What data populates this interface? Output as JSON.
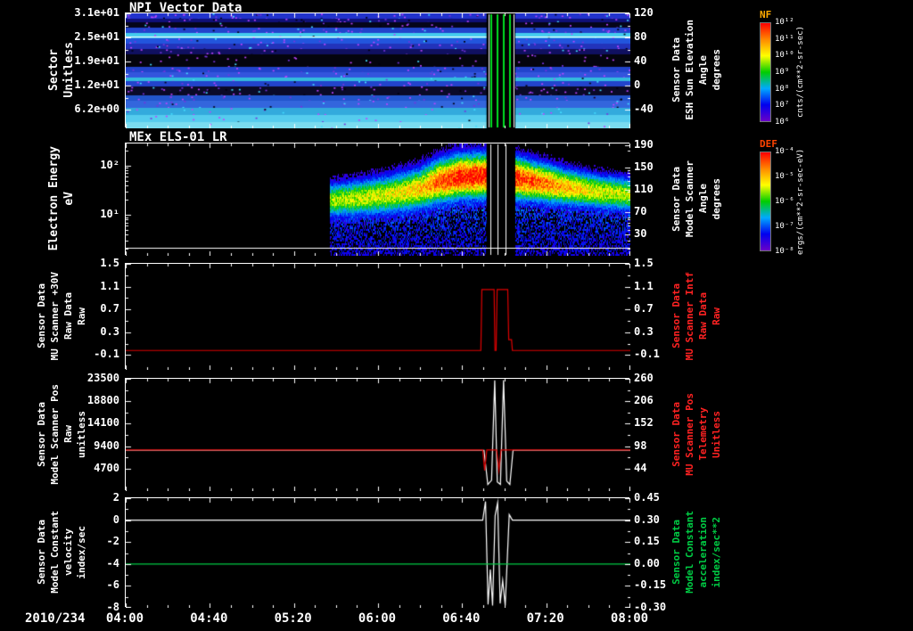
{
  "chart_data": {
    "type": "multi-panel-time-series-spectrogram",
    "date_label": "2010/234",
    "x_axis": {
      "hours_range": [
        4,
        8
      ],
      "tick_labels": [
        "04:00",
        "04:40",
        "05:20",
        "06:00",
        "06:40",
        "07:20",
        "08:00"
      ],
      "minor_divisions": 4
    },
    "palette": {
      "jet_stops": [
        "#6a00c8",
        "#0000ee",
        "#00aaff",
        "#00cc00",
        "#ffff00",
        "#ff8800",
        "#ff0000"
      ]
    },
    "event_gap": {
      "x0": 0.715,
      "x1": 0.772
    },
    "panels": [
      {
        "id": "npi-sector",
        "title": "NPI Vector Data",
        "type": "spectrogram",
        "left_label_lines": [
          "Sector",
          "Unitless"
        ],
        "left_label_size": "big",
        "left_ticks": [
          {
            "label": "3.1e+01",
            "frac": 0.0
          },
          {
            "label": "2.5e+01",
            "frac": 0.21
          },
          {
            "label": "1.9e+01",
            "frac": 0.42
          },
          {
            "label": "1.2e+01",
            "frac": 0.63
          },
          {
            "label": "6.2e+00",
            "frac": 0.84
          }
        ],
        "right_label_lines": [
          "Sensor Data",
          "ESH Sun Elevation",
          "Angle",
          "degrees"
        ],
        "right_label_color": "#ffffff",
        "right_ticks": [
          {
            "label": "120",
            "frac": 0.0
          },
          {
            "label": "80",
            "frac": 0.21
          },
          {
            "label": "40",
            "frac": 0.42
          },
          {
            "label": "0",
            "frac": 0.63
          },
          {
            "label": "-40",
            "frac": 0.84
          }
        ],
        "rows": [
          {
            "h": 6,
            "c": "#2233cc",
            "n": 0.35
          },
          {
            "h": 4,
            "c": "#101078",
            "n": 0.25
          },
          {
            "h": 6,
            "c": "#05051a",
            "n": 0.18
          },
          {
            "h": 6,
            "c": "#2244cc",
            "n": 0.3
          },
          {
            "h": 6,
            "c": "#44ccee",
            "n": 0.08
          },
          {
            "h": 6,
            "c": "#2255dd",
            "n": 0.2
          },
          {
            "h": 6,
            "c": "#2233bb",
            "n": 0.3
          },
          {
            "h": 6,
            "c": "#101060",
            "n": 0.2
          },
          {
            "h": 14,
            "c": "#04040e",
            "n": 0.12
          },
          {
            "h": 6,
            "c": "#2244cc",
            "n": 0.22
          },
          {
            "h": 6,
            "c": "#3355dd",
            "n": 0.2
          },
          {
            "h": 4,
            "c": "#33bbdd",
            "n": 0.08
          },
          {
            "h": 6,
            "c": "#2244cc",
            "n": 0.2
          },
          {
            "h": 10,
            "c": "#0a0a28",
            "n": 0.28
          },
          {
            "h": 6,
            "c": "#2255cc",
            "n": 0.2
          },
          {
            "h": 8,
            "c": "#3366dd",
            "n": 0.15
          },
          {
            "h": 8,
            "c": "#33aadd",
            "n": 0.1
          },
          {
            "h": 8,
            "c": "#55ccee",
            "n": 0.06
          },
          {
            "h": 7,
            "c": "#7adcf0",
            "n": 0.04
          }
        ],
        "overlay_line": {
          "color": "#ffffff",
          "frac": 0.2
        },
        "event": {
          "x0": 0.715,
          "x1": 0.772,
          "green_stripes": [
            0.722,
            0.7345,
            0.747,
            0.7595
          ],
          "white_lines": [
            0.7185,
            0.768
          ]
        },
        "colorbar": {
          "label": "NF",
          "label_color": "#ffaa00",
          "unit": "cnts/(cm**2-sr-sec)",
          "tick_labels": [
            "10¹²",
            "10¹¹",
            "10¹⁰",
            "10⁹",
            "10⁸",
            "10⁷",
            "10⁶"
          ]
        }
      },
      {
        "id": "els-energy",
        "title": "MEx ELS-01 LR",
        "type": "spectrogram-band",
        "left_label_lines": [
          "Electron Energy",
          "eV"
        ],
        "left_label_size": "big",
        "left_ticks": [
          {
            "label": "10²",
            "frac": 0.198
          },
          {
            "label": "10¹",
            "frac": 0.635
          }
        ],
        "log_minor": {
          "decade_fracs": [
            0.198,
            0.635,
            1.072
          ],
          "decade_height": 0.437
        },
        "right_label_lines": [
          "Sensor Data",
          "Model Scanner",
          "Angle",
          "degrees"
        ],
        "right_label_color": "#ffffff",
        "right_ticks": [
          {
            "label": "190",
            "frac": 0.016
          },
          {
            "label": "150",
            "frac": 0.214
          },
          {
            "label": "110",
            "frac": 0.413
          },
          {
            "label": "70",
            "frac": 0.611
          },
          {
            "label": "30",
            "frac": 0.81
          }
        ],
        "data_start_frac": 0.403,
        "band_keypoints": [
          {
            "x": 0.403,
            "center": 0.5,
            "width": 0.13,
            "intensity": 0.6
          },
          {
            "x": 0.46,
            "center": 0.48,
            "width": 0.14,
            "intensity": 0.63
          },
          {
            "x": 0.52,
            "center": 0.45,
            "width": 0.15,
            "intensity": 0.67
          },
          {
            "x": 0.58,
            "center": 0.4,
            "width": 0.16,
            "intensity": 0.74
          },
          {
            "x": 0.62,
            "center": 0.33,
            "width": 0.17,
            "intensity": 0.88
          },
          {
            "x": 0.66,
            "center": 0.29,
            "width": 0.17,
            "intensity": 1.0
          },
          {
            "x": 0.715,
            "center": 0.28,
            "width": 0.17,
            "intensity": 1.0
          },
          {
            "x": 0.772,
            "center": 0.3,
            "width": 0.16,
            "intensity": 0.97
          },
          {
            "x": 0.82,
            "center": 0.34,
            "width": 0.15,
            "intensity": 0.88
          },
          {
            "x": 0.87,
            "center": 0.38,
            "width": 0.14,
            "intensity": 0.78
          },
          {
            "x": 0.93,
            "center": 0.42,
            "width": 0.13,
            "intensity": 0.68
          },
          {
            "x": 1.0,
            "center": 0.45,
            "width": 0.13,
            "intensity": 0.62
          }
        ],
        "overlay_line": {
          "color": "#ffffff",
          "frac": 0.93
        },
        "event": {
          "x0": 0.715,
          "x1": 0.772,
          "white_lines": [
            0.722,
            0.7375,
            0.753
          ]
        },
        "colorbar": {
          "label": "DEF",
          "label_color": "#ff4400",
          "unit": "ergs/(cm**2-sr-sec-eV)",
          "tick_labels": [
            "10⁻⁴",
            "10⁻⁵",
            "10⁻⁶",
            "10⁻⁷",
            "10⁻⁸"
          ]
        }
      },
      {
        "id": "mu-scanner-intf",
        "title": "",
        "type": "lines",
        "left_label_lines": [
          "Sensor Data",
          "MU Scanner +30V",
          "Raw Data",
          "Raw"
        ],
        "left_label_size": "small",
        "left_ticks": [
          {
            "label": "1.5",
            "frac": 0.0
          },
          {
            "label": "1.1",
            "frac": 0.215
          },
          {
            "label": "0.7",
            "frac": 0.43
          },
          {
            "label": "0.3",
            "frac": 0.645
          },
          {
            "label": "-0.1",
            "frac": 0.86
          }
        ],
        "right_label_lines": [
          "Sensor Data",
          "MU Scanner Intf",
          "Raw Data",
          "Raw"
        ],
        "right_label_color": "#ff2222",
        "right_ticks": [
          {
            "label": "1.5",
            "frac": 0.0
          },
          {
            "label": "1.1",
            "frac": 0.215
          },
          {
            "label": "0.7",
            "frac": 0.43
          },
          {
            "label": "0.3",
            "frac": 0.645
          },
          {
            "label": "-0.1",
            "frac": 0.86
          }
        ],
        "series": [
          {
            "name": "MU Scanner Intf Raw Data",
            "color": "#dd0000",
            "range": [
              -0.36,
              1.5
            ],
            "points": [
              [
                4.0,
                -0.02
              ],
              [
                6.815,
                -0.02
              ],
              [
                6.823,
                1.05
              ],
              [
                6.92,
                1.05
              ],
              [
                6.927,
                -0.02
              ],
              [
                6.936,
                -0.02
              ],
              [
                6.944,
                1.05
              ],
              [
                7.028,
                1.05
              ],
              [
                7.036,
                0.17
              ],
              [
                7.058,
                0.17
              ],
              [
                7.065,
                -0.02
              ],
              [
                8.0,
                -0.02
              ]
            ]
          }
        ]
      },
      {
        "id": "scanner-pos",
        "title": "",
        "type": "lines",
        "left_label_lines": [
          "Sensor Data",
          "Model Scanner Pos",
          "Raw",
          "unitless"
        ],
        "left_label_size": "small",
        "left_ticks": [
          {
            "label": "23500",
            "frac": 0.0
          },
          {
            "label": "18800",
            "frac": 0.2
          },
          {
            "label": "14100",
            "frac": 0.4
          },
          {
            "label": "9400",
            "frac": 0.6
          },
          {
            "label": "4700",
            "frac": 0.8
          }
        ],
        "right_label_lines": [
          "Sensor Data",
          "MU Scanner Pos",
          "Telemetry",
          "Unitless"
        ],
        "right_label_color": "#ff2222",
        "right_ticks": [
          {
            "label": "260",
            "frac": 0.0
          },
          {
            "label": "206",
            "frac": 0.2
          },
          {
            "label": "152",
            "frac": 0.4
          },
          {
            "label": "98",
            "frac": 0.6
          },
          {
            "label": "44",
            "frac": 0.8
          }
        ],
        "series": [
          {
            "name": "MU Scanner Pos Telemetry",
            "color": "#ffffff",
            "range": [
              -10,
              260
            ],
            "points": [
              [
                4,
                88
              ],
              [
                6.84,
                88
              ],
              [
                6.87,
                6
              ],
              [
                6.9,
                16
              ],
              [
                6.925,
                256
              ],
              [
                6.945,
                12
              ],
              [
                6.97,
                6
              ],
              [
                6.995,
                257
              ],
              [
                7.02,
                14
              ],
              [
                7.045,
                6
              ],
              [
                7.07,
                88
              ],
              [
                8,
                88
              ]
            ]
          },
          {
            "name": "Model Scanner Pos Raw",
            "color": "#dd0000",
            "range": [
              0,
              23500
            ],
            "points": [
              [
                4,
                8600
              ],
              [
                6.83,
                8600
              ],
              [
                6.845,
                4300
              ],
              [
                6.862,
                8600
              ],
              [
                6.94,
                8600
              ],
              [
                6.958,
                4300
              ],
              [
                6.975,
                8600
              ],
              [
                8,
                8600
              ]
            ]
          }
        ]
      },
      {
        "id": "model-constant",
        "title": "",
        "type": "lines",
        "left_label_lines": [
          "Sensor Data",
          "Model Constant",
          "velocity",
          "index/sec"
        ],
        "left_label_size": "small",
        "left_ticks": [
          {
            "label": "2",
            "frac": 0.0
          },
          {
            "label": "0",
            "frac": 0.2
          },
          {
            "label": "-2",
            "frac": 0.4
          },
          {
            "label": "-4",
            "frac": 0.6
          },
          {
            "label": "-6",
            "frac": 0.8
          },
          {
            "label": "-8",
            "frac": 1.0
          }
        ],
        "right_label_lines": [
          "Sensor Data",
          "Model Constant",
          "acceleration",
          "index/sec**2"
        ],
        "right_label_color": "#00cc44",
        "right_ticks": [
          {
            "label": "0.45",
            "frac": 0.0
          },
          {
            "label": "0.30",
            "frac": 0.2
          },
          {
            "label": "0.15",
            "frac": 0.4
          },
          {
            "label": "0.00",
            "frac": 0.6
          },
          {
            "label": "-0.15",
            "frac": 0.8
          },
          {
            "label": "-0.30",
            "frac": 1.0
          }
        ],
        "series": [
          {
            "name": "Model Constant velocity",
            "color": "#ffffff",
            "range": [
              -8,
              2
            ],
            "points": [
              [
                4,
                0
              ],
              [
                6.83,
                0
              ],
              [
                6.852,
                1.7
              ],
              [
                6.872,
                -7.7
              ],
              [
                6.89,
                -4.5
              ],
              [
                6.908,
                -7.8
              ],
              [
                6.928,
                0.4
              ],
              [
                6.948,
                1.6
              ],
              [
                6.968,
                -7.6
              ],
              [
                6.988,
                -5.5
              ],
              [
                7.008,
                -7.8
              ],
              [
                7.04,
                0.5
              ],
              [
                7.065,
                0
              ],
              [
                8,
                0
              ]
            ]
          },
          {
            "name": "Model Constant acceleration",
            "color": "#00cc44",
            "range": [
              -0.3,
              0.45
            ],
            "points": [
              [
                4,
                0.0
              ],
              [
                8,
                0.0
              ]
            ]
          }
        ]
      }
    ]
  }
}
